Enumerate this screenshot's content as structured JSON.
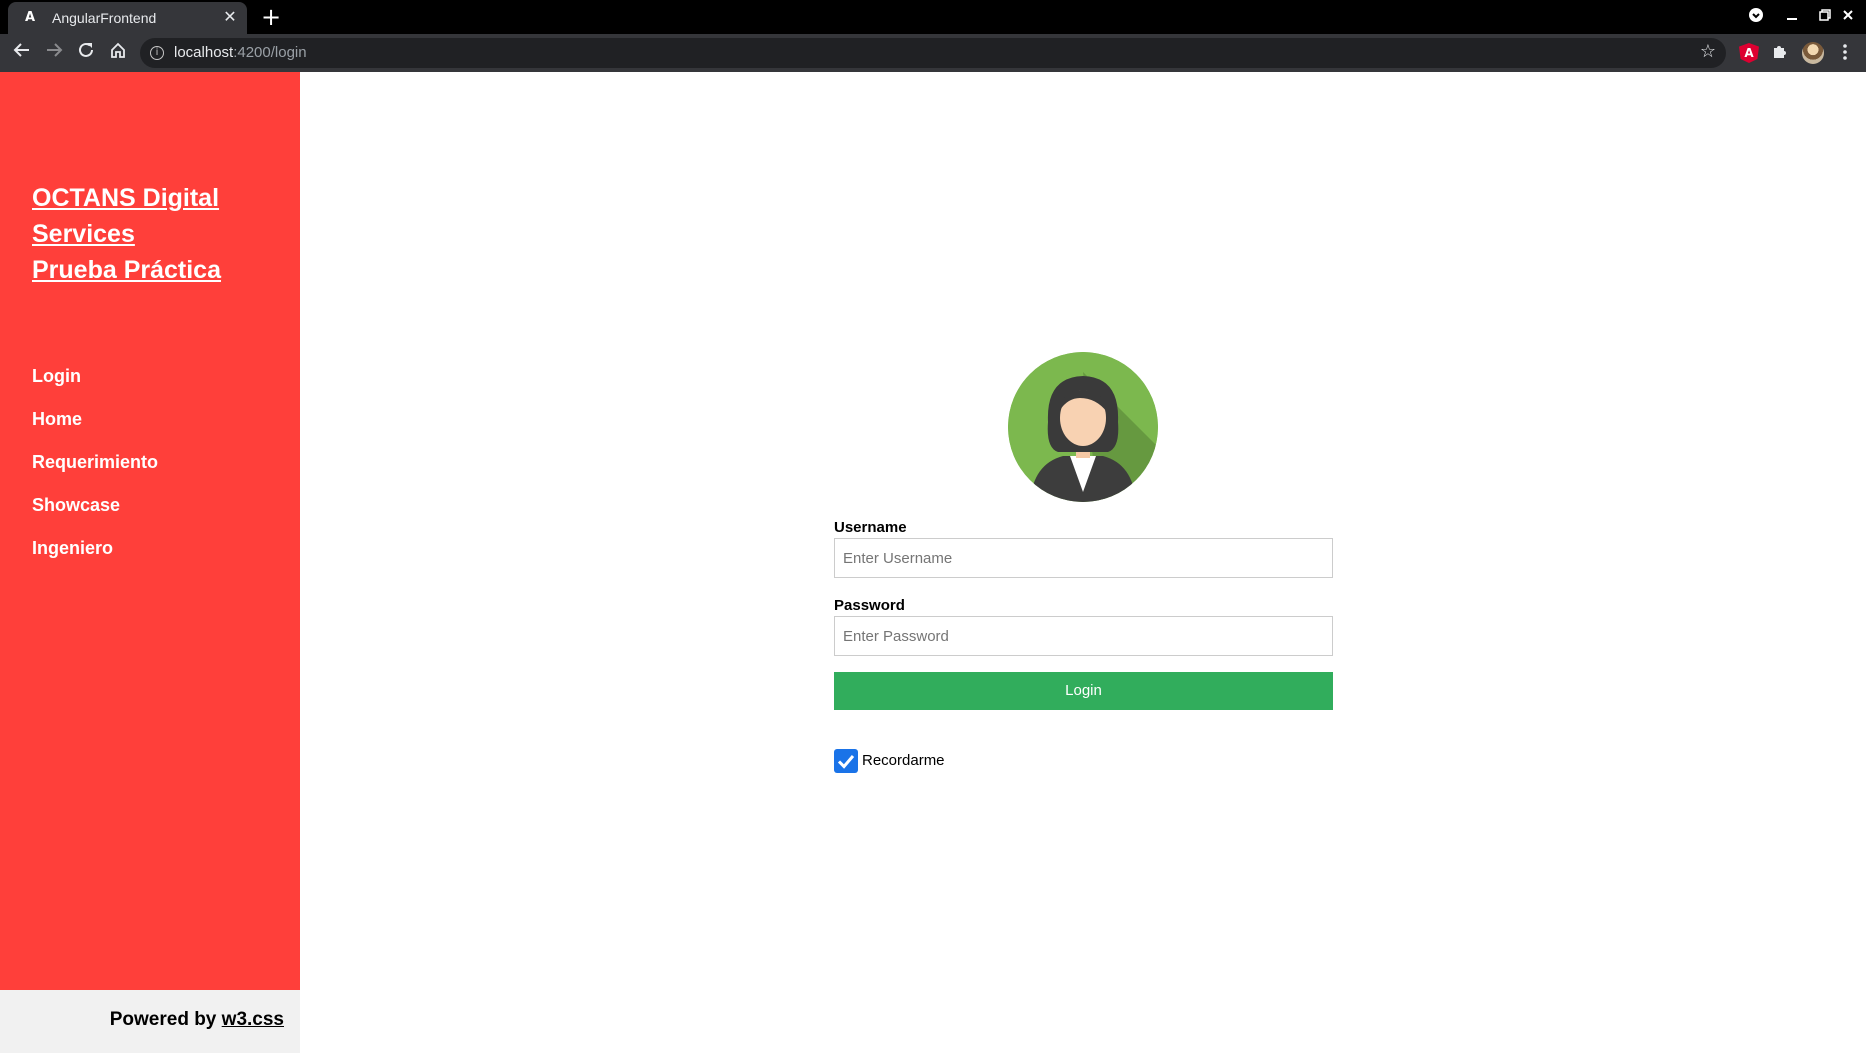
{
  "browser": {
    "tab": {
      "favicon": "A",
      "title": "AngularFrontend",
      "close": "✕"
    },
    "new_tab": "+",
    "url_host": "localhost",
    "url_rest": ":4200/login",
    "icons": {
      "back": "arrow-left-icon",
      "forward": "arrow-right-icon",
      "reload": "reload-icon",
      "home": "home-icon",
      "bookmark": "star-icon",
      "extensions": "puzzle-icon",
      "menu": "kebab-menu-icon"
    },
    "angular_ext_label": "A"
  },
  "sidebar": {
    "brand_line1": "OCTANS Digital",
    "brand_line2": "Services",
    "brand_line3": "Prueba Práctica",
    "items": [
      {
        "label": "Login"
      },
      {
        "label": "Home"
      },
      {
        "label": "Requerimiento"
      },
      {
        "label": "Showcase"
      },
      {
        "label": "Ingeniero"
      }
    ],
    "footer_prefix": "Powered by",
    "footer_link": "w3.css"
  },
  "login": {
    "username_label": "Username",
    "username_placeholder": "Enter Username",
    "username_value": "",
    "password_label": "Password",
    "password_placeholder": "Enter Password",
    "password_value": "",
    "button_label": "Login",
    "remember_label": "Recordarme",
    "remember_checked": true
  },
  "colors": {
    "sidebar": "#ff3f3a",
    "login_button": "#31ad5c",
    "checkbox": "#1a73e8",
    "avatar_bg": "#7cb84e"
  }
}
